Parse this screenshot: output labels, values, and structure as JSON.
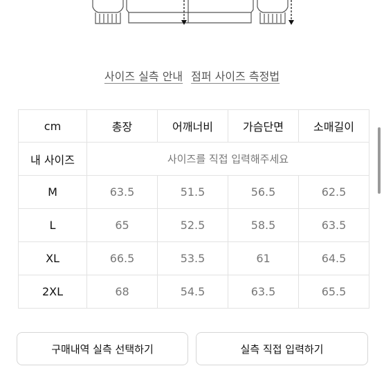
{
  "links": {
    "guide": "사이즈 실측 안내",
    "measure": "점퍼 사이즈 측정법"
  },
  "table": {
    "header": [
      "cm",
      "총장",
      "어깨너비",
      "가슴단면",
      "소매길이"
    ],
    "my_size_label": "내 사이즈",
    "my_size_hint": "사이즈를 직접 입력해주세요",
    "rows": [
      {
        "size": "M",
        "values": [
          "63.5",
          "51.5",
          "56.5",
          "62.5"
        ]
      },
      {
        "size": "L",
        "values": [
          "65",
          "52.5",
          "58.5",
          "63.5"
        ]
      },
      {
        "size": "XL",
        "values": [
          "66.5",
          "53.5",
          "61",
          "64.5"
        ]
      },
      {
        "size": "2XL",
        "values": [
          "68",
          "54.5",
          "63.5",
          "65.5"
        ]
      }
    ]
  },
  "buttons": {
    "select_history": "구매내역 실측 선택하기",
    "direct_input": "실측 직접 입력하기"
  }
}
